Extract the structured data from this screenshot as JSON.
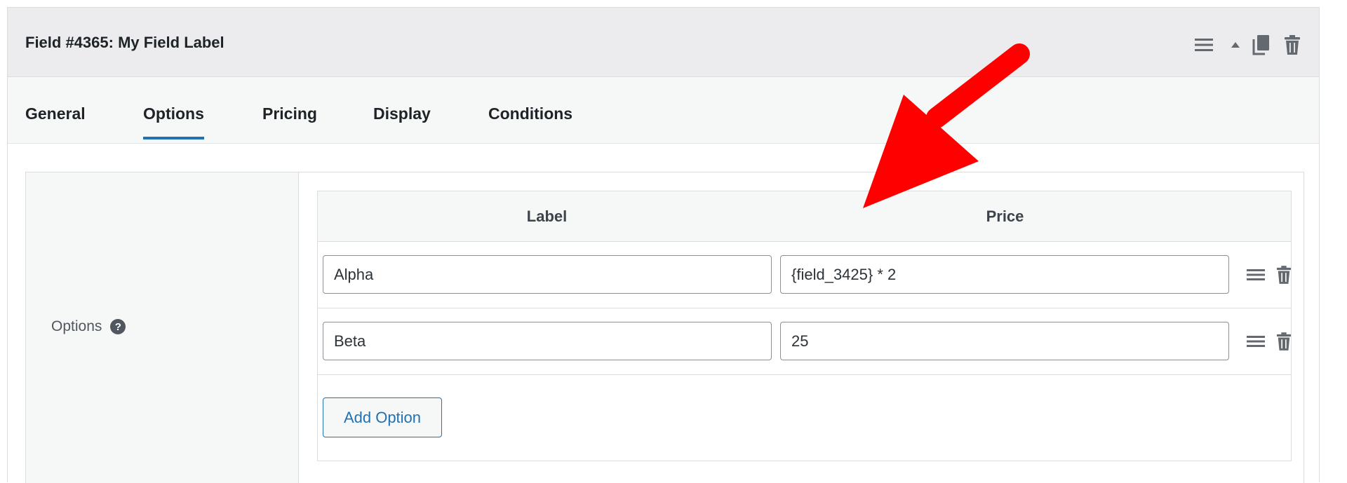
{
  "header": {
    "title": "Field #4365: My Field Label",
    "tools": [
      "menu-icon",
      "collapse-up-icon",
      "duplicate-icon",
      "trash-icon"
    ]
  },
  "tabs": [
    {
      "label": "General",
      "active": false
    },
    {
      "label": "Options",
      "active": true
    },
    {
      "label": "Pricing",
      "active": false
    },
    {
      "label": "Display",
      "active": false
    },
    {
      "label": "Conditions",
      "active": false
    }
  ],
  "options_section": {
    "label": "Options",
    "help_glyph": "?",
    "columns": {
      "label": "Label",
      "price": "Price"
    },
    "rows": [
      {
        "label": "Alpha",
        "price": "{field_3425} * 2"
      },
      {
        "label": "Beta",
        "price": "25"
      }
    ],
    "add_button": "Add Option"
  },
  "annotation": {
    "arrow_color": "#ff0000"
  },
  "colors": {
    "accent": "#2271b1",
    "header_bg": "#ececee",
    "tabs_bg": "#f6f7f7",
    "border": "#dcdcde"
  }
}
